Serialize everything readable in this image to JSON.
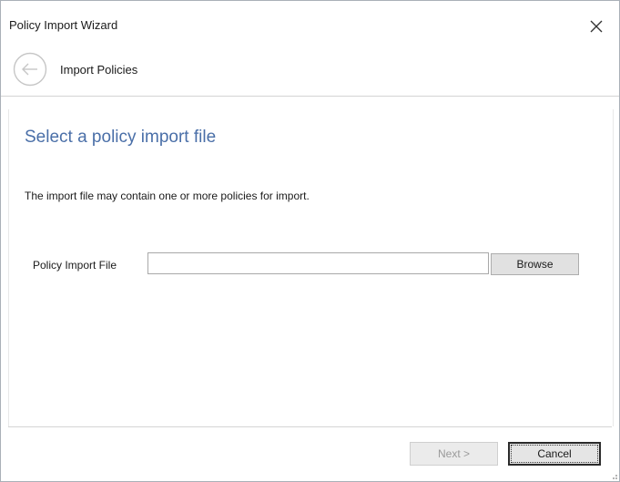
{
  "window": {
    "title": "Policy Import Wizard",
    "close_icon": "close-icon"
  },
  "nav": {
    "back_icon": "arrow-left-icon",
    "title": "Import Policies"
  },
  "page": {
    "heading": "Select a policy import file",
    "description": "The import file may contain one or more policies for import."
  },
  "form": {
    "file_label": "Policy Import File",
    "file_value": "",
    "file_placeholder": "",
    "browse_label": "Browse"
  },
  "footer": {
    "next_label": "Next >",
    "next_enabled": false,
    "cancel_label": "Cancel"
  },
  "colors": {
    "heading": "#4a6fa8",
    "button_bg": "#e1e1e1",
    "disabled_text": "#9a9a9a"
  }
}
